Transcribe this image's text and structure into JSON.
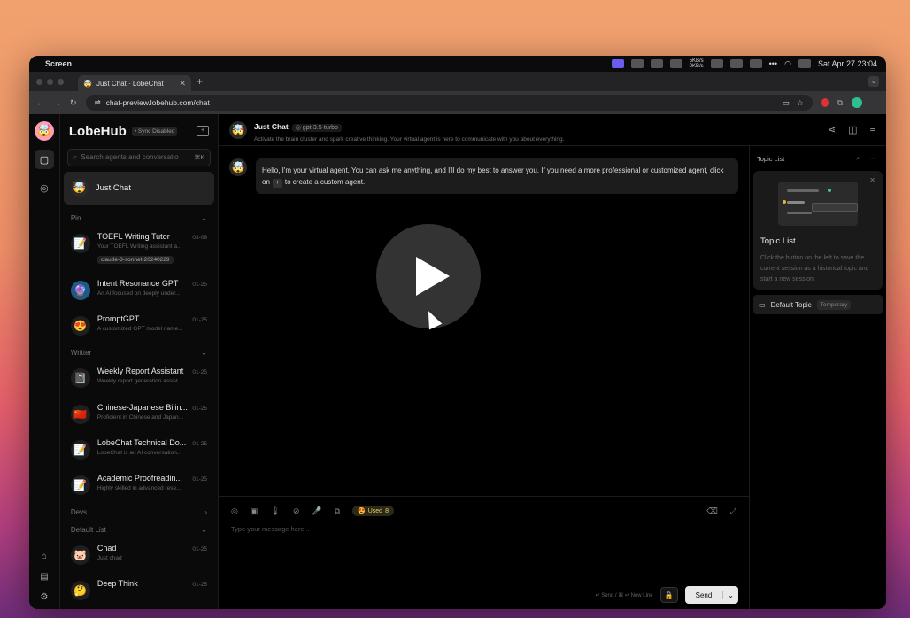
{
  "menubar": {
    "apple": "",
    "app": "Screen",
    "net_top": "5KB/s",
    "net_bottom": "0KB/s",
    "datetime": "Sat Apr 27  23:04"
  },
  "browser": {
    "tab_title": "Just Chat · LobeChat",
    "url": "chat-preview.lobehub.com/chat"
  },
  "sidebar": {
    "brand": "LobeHub",
    "sync_badge": "Sync Disabled",
    "search_placeholder": "Search agents and conversatio",
    "search_shortcut": "⌘K",
    "just_chat": "Just Chat",
    "groups": [
      {
        "label": "Pin",
        "items": [
          {
            "title": "TOEFL Writing Tutor",
            "desc": "Your TOEFL Writing assistant a...",
            "date": "03-06",
            "tag": "claude-3-sonnet-20240229",
            "emoji": "📝"
          },
          {
            "title": "Intent Resonance GPT",
            "desc": "An AI focused on deeply under...",
            "date": "01-25",
            "emoji": "🔮"
          },
          {
            "title": "PromptGPT",
            "desc": "A customized GPT model name...",
            "date": "01-25",
            "emoji": "😍"
          }
        ]
      },
      {
        "label": "Writter",
        "items": [
          {
            "title": "Weekly Report Assistant",
            "desc": "Weekly report generation assist...",
            "date": "01-25",
            "emoji": "📓"
          },
          {
            "title": "Chinese-Japanese Bilin...",
            "desc": "Proficient in Chinese and Japan...",
            "date": "01-25",
            "emoji": "🇨🇳"
          },
          {
            "title": "LobeChat Technical Do...",
            "desc": "LobeChat is an AI conversation...",
            "date": "01-25",
            "emoji": "📝"
          },
          {
            "title": "Academic Proofreadin...",
            "desc": "Highly skilled in advanced rese...",
            "date": "01-25",
            "emoji": "📝"
          }
        ]
      },
      {
        "label": "Devs"
      },
      {
        "label": "Default List",
        "items": [
          {
            "title": "Chad",
            "desc": "Just chad",
            "date": "01-25",
            "emoji": "🐷"
          },
          {
            "title": "Deep Think",
            "desc": "",
            "date": "01-25",
            "emoji": "🤔"
          }
        ]
      }
    ]
  },
  "header": {
    "title": "Just Chat",
    "model": "gpt-3.5-turbo",
    "subtitle": "Activate the brain cluster and spark creative thinking. Your virtual agent is here to communicate with you about everything."
  },
  "chat": {
    "message_a": "Hello, I'm your virtual agent. You can ask me anything, and I'll do my best to answer you. If you need a more professional or customized agent, click on",
    "message_b": "to create a custom agent."
  },
  "input": {
    "used_label": "Used",
    "used_count": "8",
    "placeholder": "Type your message here...",
    "hint": "↵ Send / ⌘ ↵ New Line",
    "send": "Send"
  },
  "topics": {
    "header": "Topic List",
    "card_title": "Topic List",
    "card_desc": "Click the button on the left to save the current session as a historical topic and start a new session.",
    "default_topic": "Default Topic",
    "temporary": "Temporary"
  }
}
